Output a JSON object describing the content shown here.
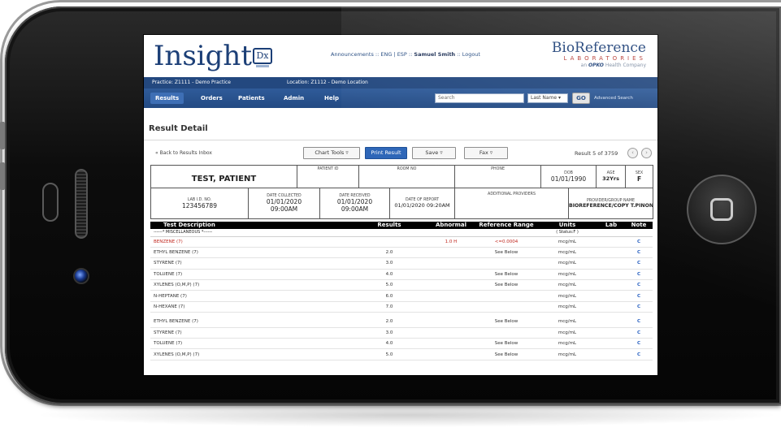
{
  "app": {
    "logo_text": "Insight",
    "logo_badge": "Dx",
    "top_links": "Announcements :: ENG | ESP ::",
    "user_name": "Samuel Smith",
    "logout": ":: Logout",
    "brand_name": "BioReference",
    "brand_sub": "LABORATORIES",
    "brand_tag_prefix": "an",
    "brand_tag_company": "OPKO",
    "brand_tag_suffix": "Health Company",
    "practice_label": "Practice:",
    "practice_value": "Z1111 - Demo Practice",
    "location_label": "Location:",
    "location_value": "Z1112 - Demo Location"
  },
  "nav": {
    "items": [
      "Results",
      "Orders",
      "Patients",
      "Admin",
      "Help"
    ],
    "search_placeholder": "Search",
    "search_by": "Last Name ▾",
    "go_label": "GO",
    "advanced_label": "Advanced Search"
  },
  "page": {
    "title": "Result Detail",
    "back_link": "« Back to Results Inbox",
    "chart_tools": "Chart Tools ▿",
    "print_result": "Print Result",
    "save": "Save ▿",
    "fax": "Fax ▿",
    "result_count": "Result 5 of 3759",
    "prev_icon": "‹",
    "next_icon": "›"
  },
  "patient": {
    "name": "TEST, PATIENT",
    "patient_id_label": "PATIENT ID",
    "patient_id": "",
    "room_label": "ROOM NO",
    "room": "",
    "phone_label": "PHONE",
    "phone": "",
    "dob_label": "DOB",
    "dob": "01/01/1990",
    "age_label": "AGE",
    "age": "32Yrs",
    "sex_label": "SEX",
    "sex": "F",
    "lab_id_label": "LAB I.D. NO.",
    "lab_id": "123456789",
    "collected_label": "DATE COLLECTED",
    "collected_date": "01/01/2020",
    "collected_time": "09:00AM",
    "received_label": "DATE RECEIVED",
    "received_date": "01/01/2020",
    "received_time": "09:00AM",
    "report_label": "DATE OF REPORT",
    "report_value": "01/01/2020 09:20AM",
    "providers_label": "ADDITIONAL PROVIDERS",
    "providers": "",
    "group_label": "PROVIDER/GROUP NAME",
    "group_value": "BIOREFERENCE/COPY T.PINON"
  },
  "results": {
    "headers": [
      "Test Description",
      "Results",
      "Abnormal",
      "Reference Range",
      "Units",
      "Lab",
      "Note"
    ],
    "section_label": "------* MISCELLANEOUS *------",
    "section_status": "( Status:F )",
    "rows": [
      {
        "desc": "BENZENE (7)",
        "result": "",
        "abnormal": "1.0  H",
        "range": "<=0.0004",
        "units": "mcg/mL",
        "lab": "",
        "note": "C"
      },
      {
        "desc": "ETHYL BENZENE (7)",
        "result": "2.0",
        "abnormal": "",
        "range": "See Below",
        "units": "mcg/mL",
        "lab": "",
        "note": "C"
      },
      {
        "desc": "STYRENE (7)",
        "result": "3.0",
        "abnormal": "",
        "range": "",
        "units": "mcg/mL",
        "lab": "",
        "note": "C"
      },
      {
        "desc": "TOLUENE (7)",
        "result": "4.0",
        "abnormal": "",
        "range": "See Below",
        "units": "mcg/mL",
        "lab": "",
        "note": "C"
      },
      {
        "desc": "XYLENES (O,M,P) (7)",
        "result": "5.0",
        "abnormal": "",
        "range": "See Below",
        "units": "mcg/mL",
        "lab": "",
        "note": "C"
      },
      {
        "desc": "N-HEPTANE (7)",
        "result": "6.0",
        "abnormal": "",
        "range": "",
        "units": "mcg/mL",
        "lab": "",
        "note": "C"
      },
      {
        "desc": "N-HEXANE (7)",
        "result": "7.0",
        "abnormal": "",
        "range": "",
        "units": "mcg/mL",
        "lab": "",
        "note": "C"
      },
      {
        "desc": "ETHYL BENZENE (7)",
        "result": "2.0",
        "abnormal": "",
        "range": "See Below",
        "units": "mcg/mL",
        "lab": "",
        "note": "C"
      },
      {
        "desc": "STYRENE (7)",
        "result": "3.0",
        "abnormal": "",
        "range": "",
        "units": "mcg/mL",
        "lab": "",
        "note": "C"
      },
      {
        "desc": "TOLUENE (7)",
        "result": "4.0",
        "abnormal": "",
        "range": "See Below",
        "units": "mcg/mL",
        "lab": "",
        "note": "C"
      },
      {
        "desc": "XYLENES (O,M,P) (7)",
        "result": "5.0",
        "abnormal": "",
        "range": "See Below",
        "units": "mcg/mL",
        "lab": "",
        "note": "C"
      }
    ]
  }
}
